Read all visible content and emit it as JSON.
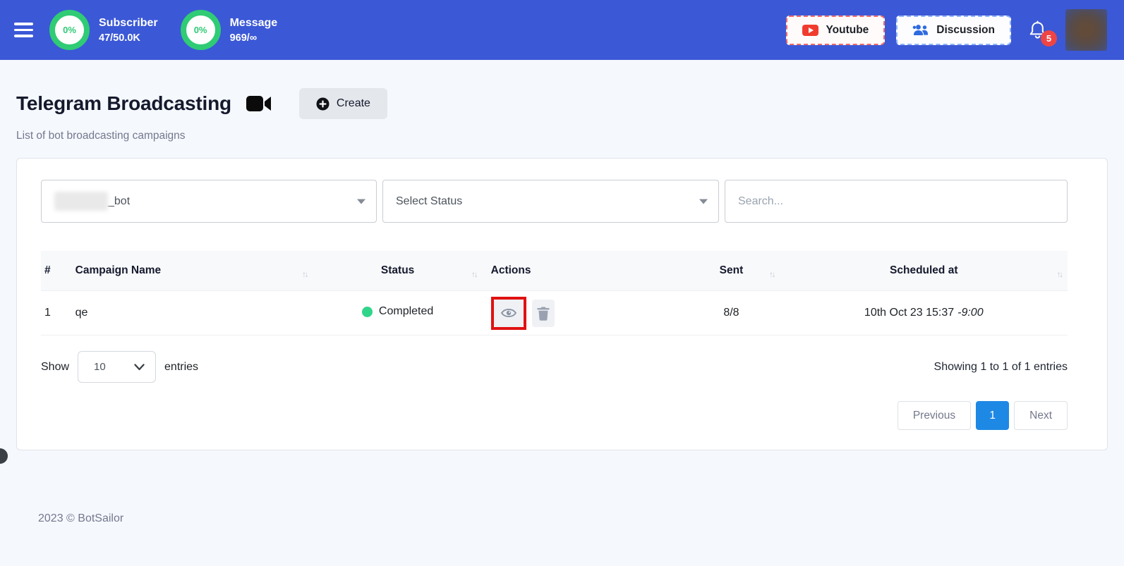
{
  "colors": {
    "header_bg": "#3b58d6",
    "progress_green": "#2fcb75",
    "notification_red": "#ef4444",
    "youtube_red": "#f03c2e",
    "discussion_blue": "#2f6bdf",
    "status_green": "#30d58a",
    "pagination_active_blue": "#1e88e5",
    "highlight_red": "#e01212"
  },
  "header": {
    "stats": [
      {
        "percent": "0%",
        "label": "Subscriber",
        "value": "47/50.0K"
      },
      {
        "percent": "0%",
        "label": "Message",
        "value": "969/∞"
      }
    ],
    "youtube_label": "Youtube",
    "discussion_label": "Discussion",
    "notification_count": "5"
  },
  "page": {
    "title": "Telegram Broadcasting",
    "subtitle": "List of bot broadcasting campaigns",
    "create_label": "Create"
  },
  "filters": {
    "bot_select_value": "_bot",
    "status_select_value": "Select Status",
    "search_placeholder": "Search..."
  },
  "table": {
    "columns": [
      "#",
      "Campaign Name",
      "Status",
      "Actions",
      "Sent",
      "Scheduled at"
    ],
    "rows": [
      {
        "index": "1",
        "campaign_name": "qe",
        "status": "Completed",
        "sent": "8/8",
        "scheduled_at": "10th Oct 23 15:37",
        "timezone": "-9:00"
      }
    ]
  },
  "table_footer": {
    "show_label": "Show",
    "entries_per_page": "10",
    "entries_label": "entries",
    "showing_text": "Showing 1 to 1 of 1 entries"
  },
  "pagination": {
    "previous_label": "Previous",
    "current_page": "1",
    "next_label": "Next"
  },
  "footer": {
    "copyright": "2023 © BotSailor"
  }
}
